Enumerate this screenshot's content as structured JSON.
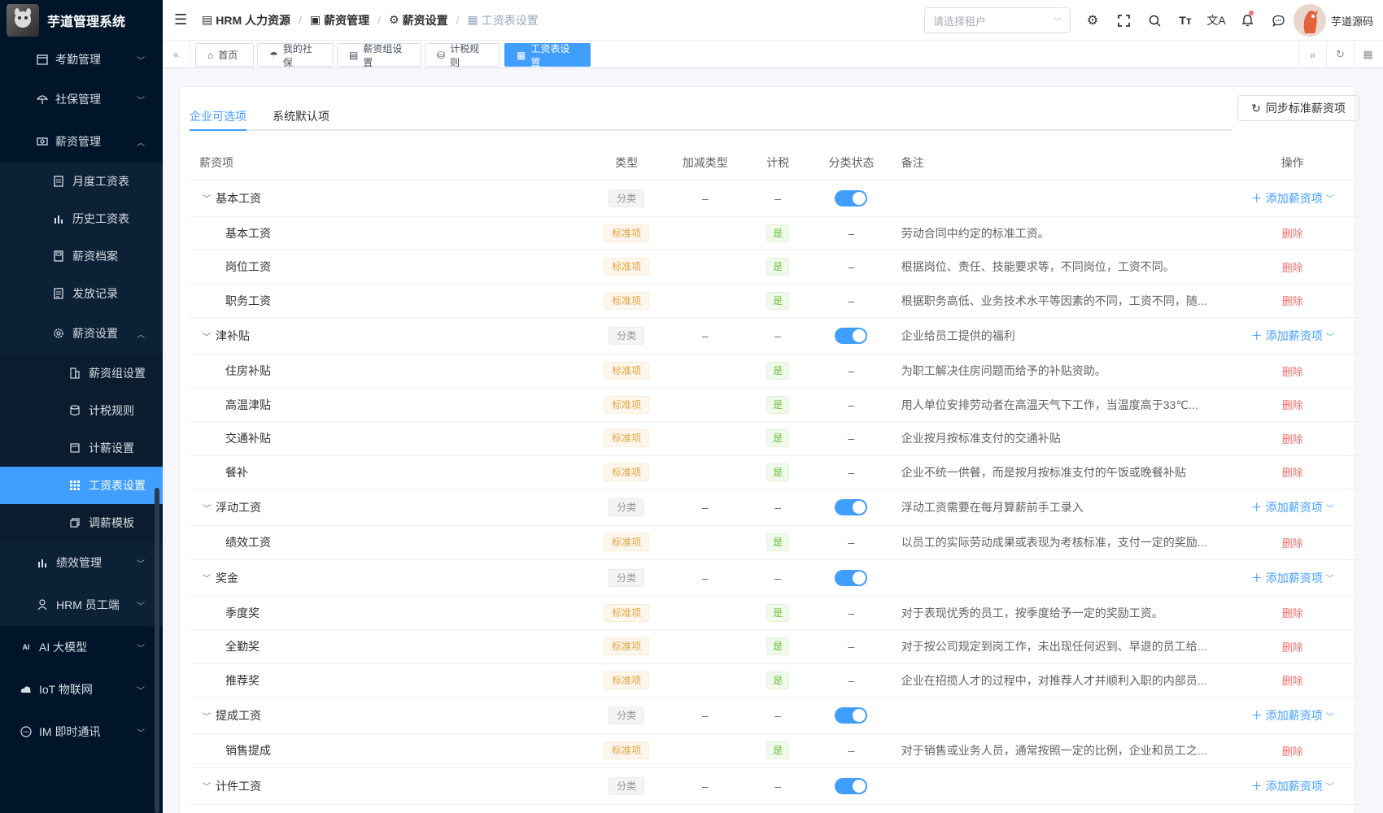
{
  "app": {
    "title": "芋道管理系统"
  },
  "sidebar": {
    "top_items": [
      {
        "label": "考勤管理",
        "icon": "calendar-icon"
      },
      {
        "label": "社保管理",
        "icon": "umbrella-icon"
      },
      {
        "label": "薪资管理",
        "icon": "money-icon"
      }
    ],
    "salary_sub": [
      {
        "label": "月度工资表",
        "icon": "document-icon"
      },
      {
        "label": "历史工资表",
        "icon": "bar-chart-icon"
      },
      {
        "label": "薪资档案",
        "icon": "archive-icon"
      },
      {
        "label": "发放记录",
        "icon": "list-icon"
      },
      {
        "label": "薪资设置",
        "icon": "gear-icon"
      }
    ],
    "settings_sub": [
      {
        "label": "薪资组设置",
        "icon": "building-icon"
      },
      {
        "label": "计税规则",
        "icon": "database-icon"
      },
      {
        "label": "计薪设置",
        "icon": "calendar-icon"
      },
      {
        "label": "工资表设置",
        "icon": "grid-icon"
      },
      {
        "label": "调薪模板",
        "icon": "copy-icon"
      }
    ],
    "bottom_items": [
      {
        "label": "绩效管理",
        "icon": "bar-chart-icon"
      },
      {
        "label": "HRM 员工端",
        "icon": "user-icon"
      },
      {
        "label": "AI 大模型",
        "icon": "ai-icon"
      },
      {
        "label": "IoT 物联网",
        "icon": "cloud-icon"
      },
      {
        "label": "IM 即时通讯",
        "icon": "chat-icon"
      }
    ]
  },
  "header": {
    "breadcrumb": [
      "HRM 人力资源",
      "薪资管理",
      "薪资设置",
      "工资表设置"
    ],
    "tenant_placeholder": "请选择租户",
    "username": "芋道源码"
  },
  "tabs": [
    "首页",
    "我的社保",
    "薪资组设置",
    "计税规则",
    "工资表设置"
  ],
  "content": {
    "tabs": [
      "企业可选项",
      "系统默认项"
    ],
    "sync_button": "同步标准薪资项",
    "columns": [
      "薪资项",
      "类型",
      "加减类型",
      "计税",
      "分类状态",
      "备注",
      "操作"
    ],
    "category_tag": "分类",
    "standard_tag": "标准项",
    "yes_tag": "是",
    "dash": "–",
    "add_label": "添加薪资项",
    "delete_label": "删除",
    "groups": [
      {
        "name": "基本工资",
        "note": "",
        "items": [
          {
            "name": "基本工资",
            "note": "劳动合同中约定的标准工资。"
          },
          {
            "name": "岗位工资",
            "note": "根据岗位、责任、技能要求等，不同岗位，工资不同。"
          },
          {
            "name": "职务工资",
            "note": "根据职务高低、业务技术水平等因素的不同，工资不同，随..."
          }
        ]
      },
      {
        "name": "津补贴",
        "note": "企业给员工提供的福利",
        "items": [
          {
            "name": "住房补贴",
            "note": "为职工解决住房问题而给予的补贴资助。"
          },
          {
            "name": "高温津贴",
            "note": "用人单位安排劳动者在高温天气下工作，当温度高于33℃..."
          },
          {
            "name": "交通补贴",
            "note": "企业按月按标准支付的交通补贴"
          },
          {
            "name": "餐补",
            "note": "企业不统一供餐，而是按月按标准支付的午饭或晚餐补贴"
          }
        ]
      },
      {
        "name": "浮动工资",
        "note": "浮动工资需要在每月算薪前手工录入",
        "items": [
          {
            "name": "绩效工资",
            "note": "以员工的实际劳动成果或表现为考核标准，支付一定的奖励..."
          }
        ]
      },
      {
        "name": "奖金",
        "note": "",
        "items": [
          {
            "name": "季度奖",
            "note": "对于表现优秀的员工，按季度给予一定的奖励工资。"
          },
          {
            "name": "全勤奖",
            "note": "对于按公司规定到岗工作，未出现任何迟到、早退的员工给..."
          },
          {
            "name": "推荐奖",
            "note": "企业在招揽人才的过程中，对推荐人才并顺利入职的内部员..."
          }
        ]
      },
      {
        "name": "提成工资",
        "note": "",
        "items": [
          {
            "name": "销售提成",
            "note": "对于销售或业务人员，通常按照一定的比例，企业和员工之..."
          }
        ]
      },
      {
        "name": "计件工资",
        "note": "",
        "items": []
      }
    ]
  }
}
